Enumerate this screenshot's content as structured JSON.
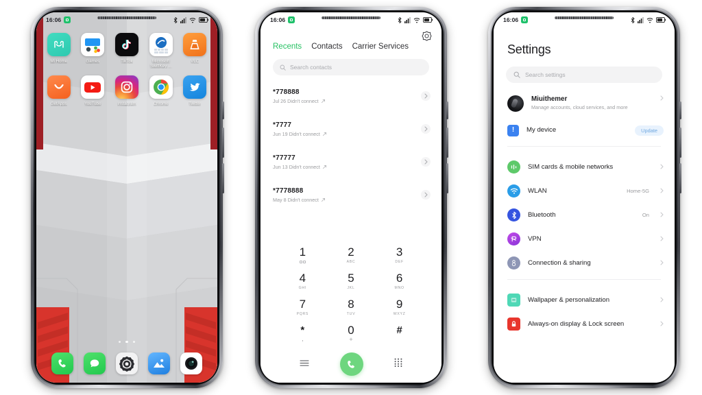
{
  "status_bar": {
    "time": "16:06",
    "badge_icon": "app-badge-icon",
    "icons": [
      "bluetooth-icon",
      "signal-icon",
      "wifi-icon",
      "battery-icon"
    ]
  },
  "phone1": {
    "name": "Home screen",
    "apps_row1": [
      {
        "label": "Mi Home",
        "icon": "mi-home-icon"
      },
      {
        "label": "Games",
        "icon": "games-icon"
      },
      {
        "label": "TikTok",
        "icon": "tiktok-icon"
      },
      {
        "label": "Microsoft SwiftKey ...",
        "icon": "swiftkey-icon"
      },
      {
        "label": "VLC",
        "icon": "vlc-icon"
      }
    ],
    "apps_row2": [
      {
        "label": "GetApps",
        "icon": "getapps-icon"
      },
      {
        "label": "YouTube",
        "icon": "youtube-icon"
      },
      {
        "label": "Instagram",
        "icon": "instagram-icon"
      },
      {
        "label": "Chrome",
        "icon": "chrome-icon"
      },
      {
        "label": "Twitter",
        "icon": "twitter-icon"
      }
    ],
    "dock": [
      {
        "label": "Phone",
        "icon": "phone-icon"
      },
      {
        "label": "Messages",
        "icon": "messages-icon"
      },
      {
        "label": "Settings",
        "icon": "settings-gear-icon"
      },
      {
        "label": "Gallery",
        "icon": "gallery-icon"
      },
      {
        "label": "Camera",
        "icon": "camera-icon"
      }
    ],
    "page_dots": 3,
    "active_dot": 1
  },
  "phone2": {
    "name": "Dialer",
    "settings_icon": "gear-icon",
    "tabs": [
      {
        "label": "Recents",
        "active": true
      },
      {
        "label": "Contacts",
        "active": false
      },
      {
        "label": "Carrier Services",
        "active": false
      }
    ],
    "search": {
      "placeholder": "Search contacts",
      "icon": "search-icon"
    },
    "calls": [
      {
        "number": "*778888",
        "detail": "Jul 26 Didn't connect"
      },
      {
        "number": "*7777",
        "detail": "Jun 19 Didn't connect"
      },
      {
        "number": "*77777",
        "detail": "Jun 13 Didn't connect"
      },
      {
        "number": "*7778888",
        "detail": "May 8 Didn't connect"
      }
    ],
    "keypad": [
      {
        "digit": "1",
        "sub": "",
        "voicemail": true
      },
      {
        "digit": "2",
        "sub": "ABC"
      },
      {
        "digit": "3",
        "sub": "DEF"
      },
      {
        "digit": "4",
        "sub": "GHI"
      },
      {
        "digit": "5",
        "sub": "JKL"
      },
      {
        "digit": "6",
        "sub": "MNO"
      },
      {
        "digit": "7",
        "sub": "PQRS"
      },
      {
        "digit": "8",
        "sub": "TUV"
      },
      {
        "digit": "9",
        "sub": "WXYZ"
      },
      {
        "digit": "*",
        "sub": ","
      },
      {
        "digit": "0",
        "sub": "+"
      },
      {
        "digit": "#",
        "sub": ""
      }
    ],
    "actions": {
      "menu": "hamburger-menu-icon",
      "call": "call-button-icon",
      "keypad_toggle": "keypad-grid-icon"
    },
    "accent_green": "#27c163",
    "call_button_color": "#6ed67f"
  },
  "phone3": {
    "name": "Settings",
    "title": "Settings",
    "search": {
      "placeholder": "Search settings",
      "icon": "search-icon"
    },
    "account": {
      "name": "Miuithemer",
      "subtitle": "Manage accounts, cloud services, and more",
      "avatar": "account-avatar"
    },
    "device": {
      "label": "My device",
      "badge": "Update",
      "icon": "device-info-icon",
      "badge_color": "#e8f2fd"
    },
    "group1": [
      {
        "label": "SIM cards & mobile networks",
        "value": "",
        "icon": "sim-card-icon",
        "color": "#5ec96a"
      },
      {
        "label": "WLAN",
        "value": "Home-5G",
        "icon": "wifi-icon",
        "color": "#2a9de8"
      },
      {
        "label": "Bluetooth",
        "value": "On",
        "icon": "bluetooth-icon",
        "color": "#3554e0"
      },
      {
        "label": "VPN",
        "value": "",
        "icon": "vpn-icon",
        "color": "#a63fe0"
      },
      {
        "label": "Connection & sharing",
        "value": "",
        "icon": "sharing-icon",
        "color": "#8e96b5"
      }
    ],
    "group2": [
      {
        "label": "Wallpaper & personalization",
        "value": "",
        "icon": "wallpaper-icon",
        "color": "#4fd8b6"
      },
      {
        "label": "Always-on display & Lock screen",
        "value": "",
        "icon": "lock-icon",
        "color": "#e8362d"
      }
    ]
  }
}
